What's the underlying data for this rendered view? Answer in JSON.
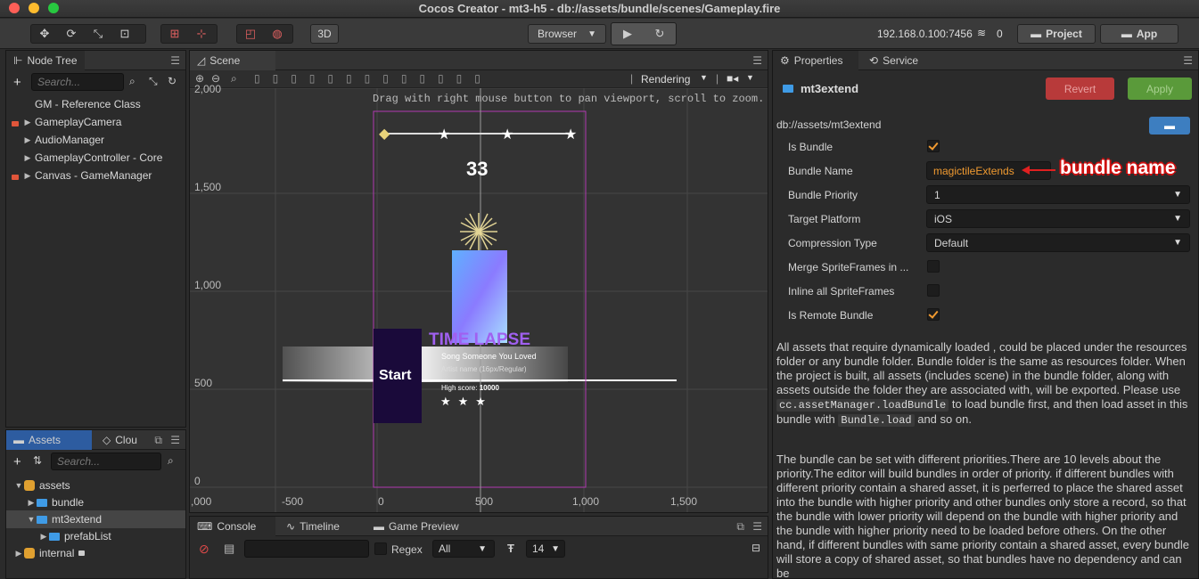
{
  "window": {
    "title": "Cocos Creator - mt3-h5 - db://assets/bundle/scenes/Gameplay.fire"
  },
  "toolbar": {
    "mode_3d": "3D",
    "browser": "Browser",
    "ip": "192.168.0.100:7456",
    "wifi_count": "0",
    "project_btn": "Project",
    "app_btn": "App"
  },
  "node_tree": {
    "tab": "Node Tree",
    "search_placeholder": "Search...",
    "items": [
      {
        "label": "GM - Reference Class",
        "locked": false,
        "caret": false
      },
      {
        "label": "GameplayCamera",
        "locked": true,
        "caret": true
      },
      {
        "label": "AudioManager",
        "locked": false,
        "caret": true
      },
      {
        "label": "GameplayController - Core",
        "locked": false,
        "caret": true
      },
      {
        "label": "Canvas - GameManager",
        "locked": true,
        "caret": true
      }
    ]
  },
  "assets": {
    "tab": "Assets",
    "tab2": "Clou",
    "search_placeholder": "Search...",
    "items": [
      {
        "label": "assets"
      },
      {
        "label": "bundle"
      },
      {
        "label": "mt3extend"
      },
      {
        "label": "prefabList"
      },
      {
        "label": "internal"
      }
    ]
  },
  "scene": {
    "tab": "Scene",
    "rendering": "Rendering",
    "hint": "Drag with right mouse button to pan viewport, scroll to zoom.",
    "y_labels": [
      "2,000",
      "1,500",
      "1,000",
      "500",
      "0"
    ],
    "x_labels": [
      ",000",
      "-500",
      "0",
      "500",
      "1,000",
      "1,500"
    ],
    "score": "33",
    "start": "Start",
    "song_title": "TIME LAPSE",
    "song_name": "Song Someone You Loved",
    "artist": "Artist name (16px/Regular)",
    "high_score_label": "High score:",
    "high_score_value": "10000"
  },
  "console": {
    "tab_console": "Console",
    "tab_timeline": "Timeline",
    "tab_preview": "Game Preview",
    "regex": "Regex",
    "filter": "All",
    "font_size": "14"
  },
  "properties": {
    "tab": "Properties",
    "tab2": "Service",
    "name": "mt3extend",
    "revert": "Revert",
    "apply": "Apply",
    "path": "db://assets/mt3extend",
    "is_bundle": {
      "label": "Is Bundle",
      "checked": true
    },
    "bundle_name": {
      "label": "Bundle Name",
      "value": "magictileExtends"
    },
    "annotation": "bundle name",
    "bundle_priority": {
      "label": "Bundle Priority",
      "value": "1"
    },
    "target_platform": {
      "label": "Target Platform",
      "value": "iOS"
    },
    "compression": {
      "label": "Compression Type",
      "value": "Default"
    },
    "merge": {
      "label": "Merge SpriteFrames in ...",
      "checked": false
    },
    "inline": {
      "label": "Inline all SpriteFrames",
      "checked": false
    },
    "remote": {
      "label": "Is Remote Bundle",
      "checked": true
    },
    "desc1_a": "All assets that require dynamically loaded , could be placed under the resources folder or any bundle folder. Bundle folder is the same as resources folder. When the project is built, all assets (includes scene) in the bundle folder, along with assets outside the folder they are associated with, will be exported. Please use ",
    "desc1_code1": "cc.assetManager.loadBundle",
    "desc1_b": " to load bundle first, and then load asset in this bundle with ",
    "desc1_code2": "Bundle.load",
    "desc1_c": " and so on.",
    "desc2": "The bundle can be set with different priorities.There are 10 levels about the priority.The editor will build bundles in order of priority. if different bundles with different priority contain a shared asset, it is perferred to place the shared asset into the bundle with higher priority and other bundles only store a record, so that the bundle with lower priority will depend on the bundle with higher priority and the bundle with higher priority need to be loaded before others. On the other hand, if different bundles with same priority contain a shared asset, every bundle will store a copy of shared asset, so that bundles have no dependency and can be"
  }
}
